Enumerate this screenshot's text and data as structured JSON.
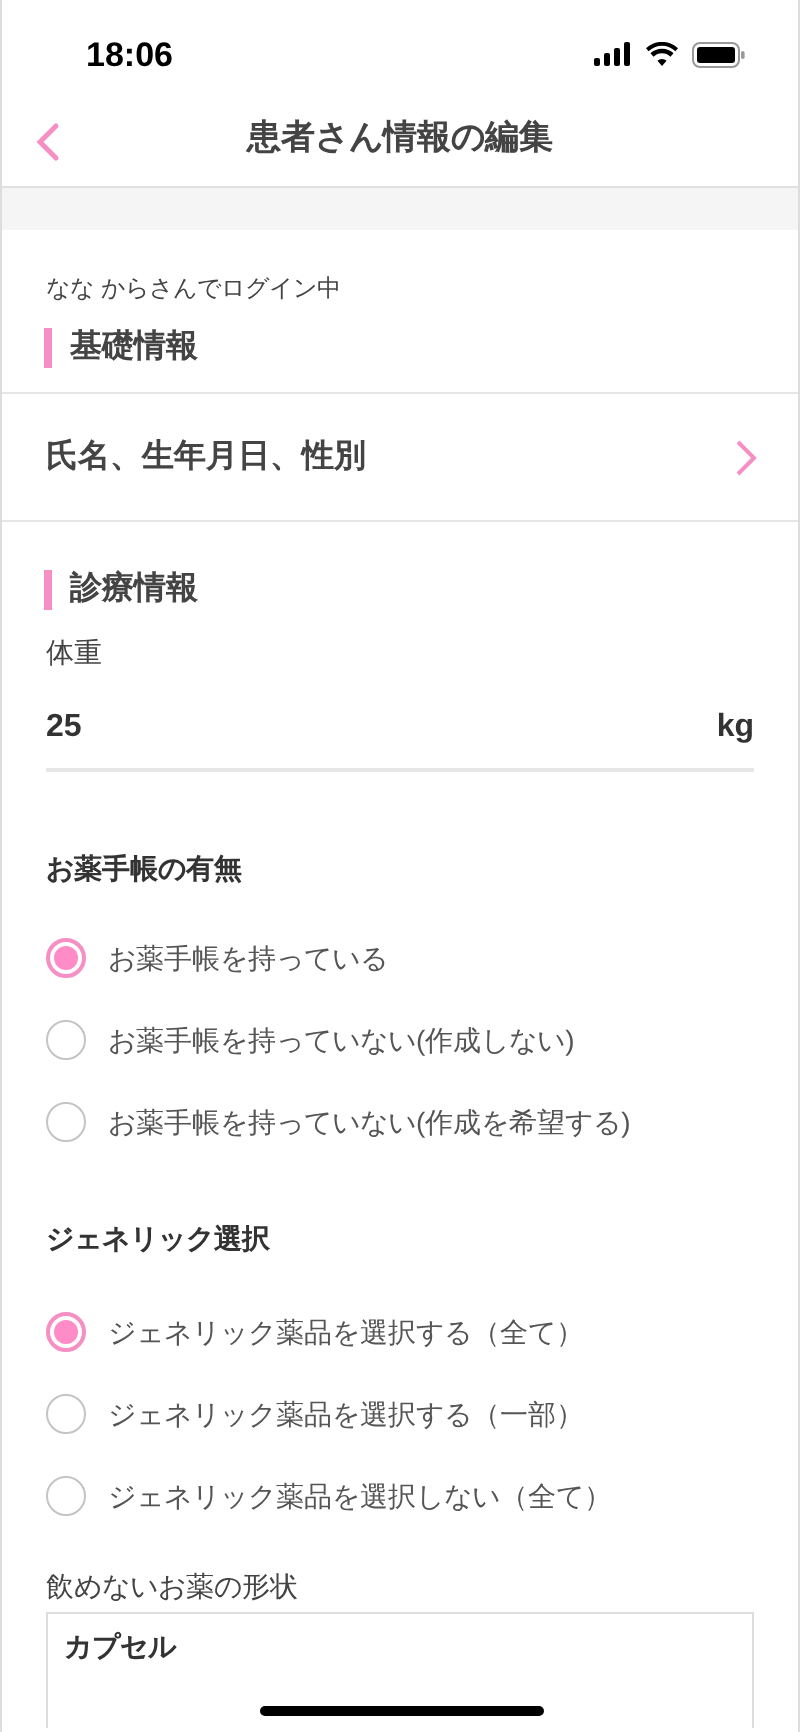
{
  "status_bar": {
    "time": "18:06"
  },
  "nav": {
    "title": "患者さん情報の編集"
  },
  "login_note": "なな からさんでログイン中",
  "basic_section": {
    "heading": "基礎情報",
    "rows": [
      {
        "label": "氏名、生年月日、性別"
      }
    ]
  },
  "medical_section": {
    "heading": "診療情報",
    "weight": {
      "label": "体重",
      "value": "25",
      "unit": "kg"
    },
    "groups": [
      {
        "title": "お薬手帳の有無",
        "options": [
          {
            "label": "お薬手帳を持っている",
            "selected": true
          },
          {
            "label": "お薬手帳を持っていない(作成しない)",
            "selected": false
          },
          {
            "label": "お薬手帳を持っていない(作成を希望する)",
            "selected": false
          }
        ]
      },
      {
        "title": "ジェネリック選択",
        "options": [
          {
            "label": "ジェネリック薬品を選択する（全て）",
            "selected": true
          },
          {
            "label": "ジェネリック薬品を選択する（一部）",
            "selected": false
          },
          {
            "label": "ジェネリック薬品を選択しない（全て）",
            "selected": false
          }
        ]
      }
    ],
    "dosage_form": {
      "label": "飲めないお薬の形状",
      "value": "カプセル"
    }
  }
}
